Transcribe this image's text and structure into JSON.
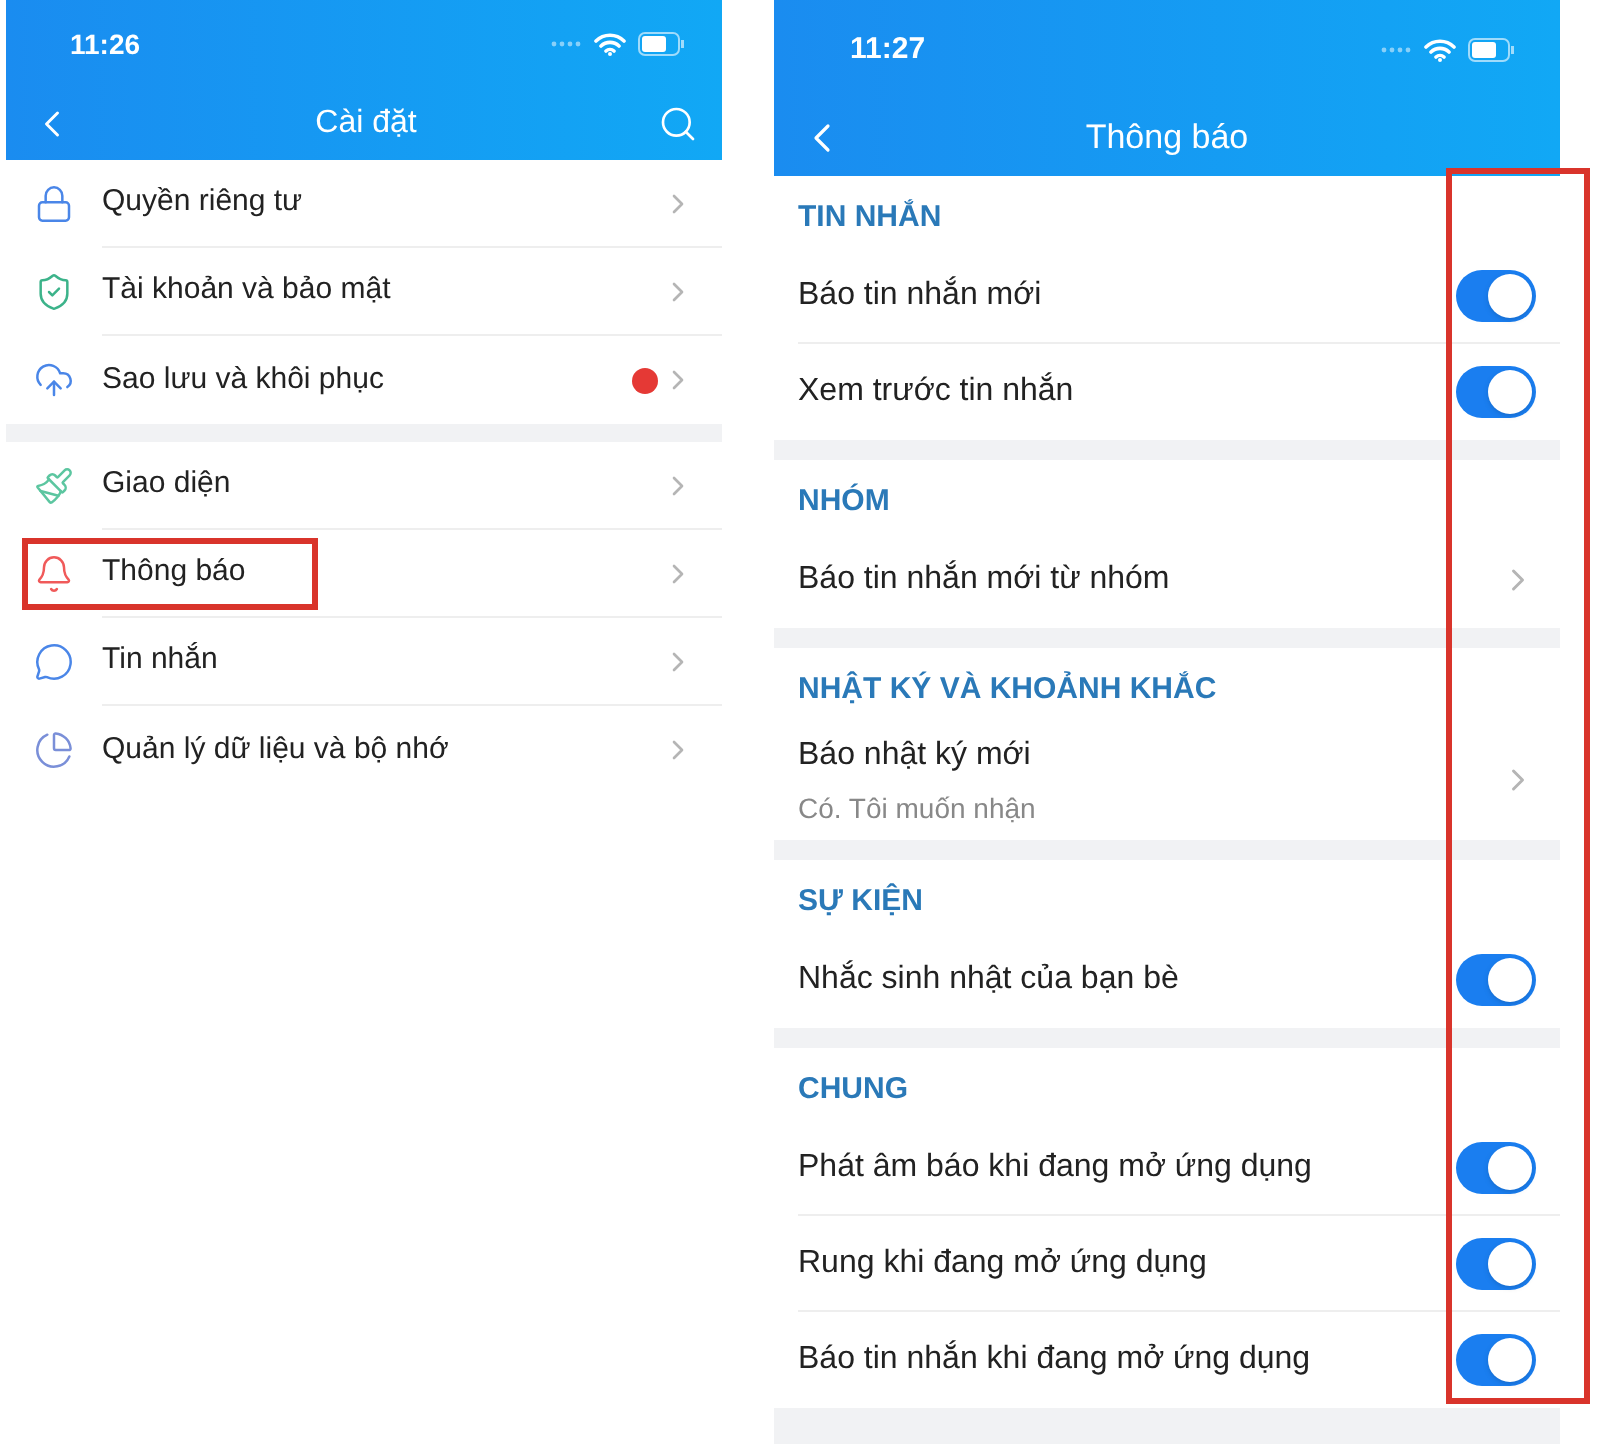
{
  "settings_screen": {
    "status_bar": {
      "time": "11:26"
    },
    "title": "Cài đặt",
    "groups": [
      [
        {
          "label": "Quyền riêng tư",
          "alert": false,
          "highlighted": false
        },
        {
          "label": "Tài khoản và bảo mật",
          "alert": false,
          "highlighted": false
        },
        {
          "label": "Sao lưu và khôi phục",
          "alert": true,
          "highlighted": false
        }
      ],
      [
        {
          "label": "Giao diện",
          "alert": false,
          "highlighted": false
        },
        {
          "label": "Thông báo",
          "alert": false,
          "highlighted": true
        },
        {
          "label": "Tin nhắn",
          "alert": false,
          "highlighted": false
        },
        {
          "label": "Quản lý dữ liệu và bộ nhớ",
          "alert": false,
          "highlighted": false
        }
      ]
    ]
  },
  "notifications_screen": {
    "status_bar": {
      "time": "11:27"
    },
    "title": "Thông báo",
    "toggles_highlighted": true,
    "sections": [
      {
        "title": "TIN NHẮN",
        "rows": [
          {
            "kind": "toggle",
            "label": "Báo tin nhắn mới",
            "on": true
          },
          {
            "kind": "toggle",
            "label": "Xem trước tin nhắn",
            "on": true
          }
        ]
      },
      {
        "title": "NHÓM",
        "rows": [
          {
            "kind": "link",
            "label": "Báo tin nhắn mới từ nhóm"
          }
        ]
      },
      {
        "title": "NHẬT KÝ VÀ KHOẢNH KHẮC",
        "rows": [
          {
            "kind": "link",
            "label": "Báo nhật ký mới",
            "subtitle": "Có. Tôi muốn nhận"
          }
        ]
      },
      {
        "title": "SỰ KIỆN",
        "rows": [
          {
            "kind": "toggle",
            "label": "Nhắc sinh nhật của bạn bè",
            "on": true
          }
        ]
      },
      {
        "title": "CHUNG",
        "rows": [
          {
            "kind": "toggle",
            "label": "Phát âm báo khi đang mở ứng dụng",
            "on": true
          },
          {
            "kind": "toggle",
            "label": "Rung khi đang mở ứng dụng",
            "on": true
          },
          {
            "kind": "toggle",
            "label": "Báo tin nhắn khi đang mở ứng dụng",
            "on": true
          }
        ]
      }
    ]
  }
}
